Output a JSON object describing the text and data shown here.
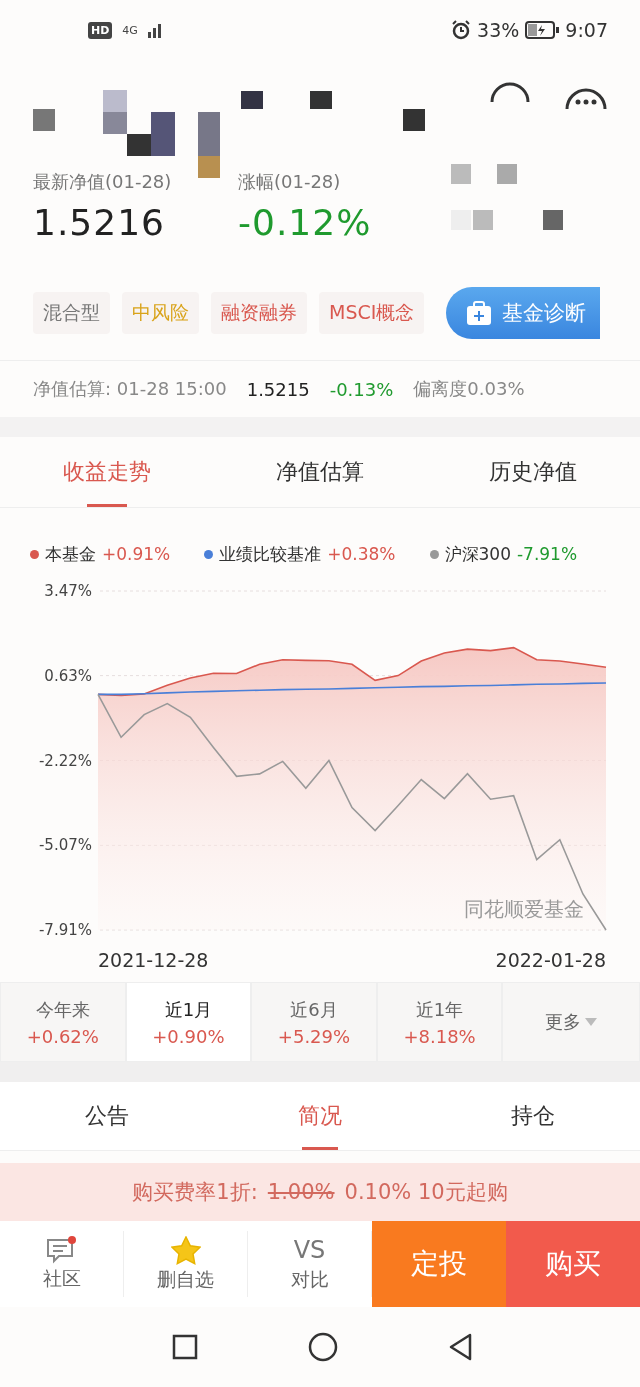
{
  "status_bar": {
    "hd": "HD",
    "network": "4G",
    "battery": "33%",
    "time": "9:07"
  },
  "fund": {
    "nav_label": "最新净值(01-28)",
    "nav": "1.5216",
    "change_label": "涨幅(01-28)",
    "change": "-0.12%",
    "change_falling": true,
    "tags": [
      {
        "label": "混合型",
        "color": "#777777"
      },
      {
        "label": "中风险",
        "color": "#d9a31a"
      },
      {
        "label": "融资融券",
        "color": "#d9584f"
      },
      {
        "label": "MSCI概念",
        "color": "#d9584f"
      }
    ],
    "diagnose_button": "基金诊断"
  },
  "estimate": {
    "label": "净值估算: 01-28 15:00",
    "value": "1.5215",
    "change": "-0.13%",
    "change_falling": true,
    "deviation": "偏离度0.03%"
  },
  "performance": {
    "tabs": [
      {
        "label": "收益走势",
        "selected": true
      },
      {
        "label": "净值估算",
        "selected": false
      },
      {
        "label": "历史净值",
        "selected": false
      }
    ],
    "legend": [
      {
        "value": "+0.91%",
        "falling": false
      },
      {
        "value": "+0.38%",
        "falling": false
      },
      {
        "value": "-7.91%",
        "falling": true
      }
    ],
    "watermark": "同花顺爱基金",
    "start_date": "2021-12-28",
    "end_date": "2022-01-28",
    "chart_data": {
      "type": "line",
      "grid": true,
      "categories": [
        null,
        null,
        null,
        null,
        null,
        null,
        null,
        null,
        null,
        null,
        null,
        null,
        null,
        null,
        null,
        null,
        null,
        null,
        null,
        null,
        null,
        null,
        null
      ],
      "ylim": [
        -7.91,
        3.47
      ],
      "yticks": [
        {
          "value": 3.47,
          "label": "3.47%"
        },
        {
          "value": 0.63,
          "label": "0.63%"
        },
        {
          "value": -2.22,
          "label": "-2.22%"
        },
        {
          "value": -5.07,
          "label": "-5.07%"
        },
        {
          "value": -7.91,
          "label": "-7.91%"
        }
      ],
      "series": [
        {
          "name": "本基金",
          "color": "#d9584f",
          "values": [
            0,
            -0.04,
            0.01,
            0.31,
            0.55,
            0.71,
            0.7,
            1.01,
            1.16,
            1.14,
            1.13,
            1.01,
            0.47,
            0.63,
            1.12,
            1.39,
            1.52,
            1.47,
            1.57,
            1.16,
            1.12,
            1.02,
            0.91
          ]
        },
        {
          "name": "业绩比较基准",
          "color": "#4a7fd8",
          "values": [
            0,
            0,
            0.02,
            0.05,
            0.08,
            0.1,
            0.12,
            0.14,
            0.16,
            0.17,
            0.18,
            0.2,
            0.22,
            0.24,
            0.26,
            0.27,
            0.29,
            0.3,
            0.32,
            0.34,
            0.35,
            0.37,
            0.38
          ]
        },
        {
          "name": "沪深300",
          "color": "#999999",
          "values": [
            0,
            -1.44,
            -0.68,
            -0.31,
            -0.77,
            -1.78,
            -2.75,
            -2.67,
            -2.25,
            -3.15,
            -2.22,
            -3.8,
            -4.57,
            -3.73,
            -2.86,
            -3.5,
            -2.66,
            -3.52,
            -3.4,
            -5.55,
            -4.88,
            -6.7,
            -7.91
          ]
        }
      ]
    },
    "periods": [
      {
        "label": "今年来",
        "value": "+0.62%",
        "selected": false
      },
      {
        "label": "近1月",
        "value": "+0.90%",
        "selected": true
      },
      {
        "label": "近6月",
        "value": "+5.29%",
        "selected": false
      },
      {
        "label": "近1年",
        "value": "+8.18%",
        "selected": false
      }
    ],
    "more_button": "更多"
  },
  "info_tabs": [
    {
      "label": "公告",
      "selected": false
    },
    {
      "label": "简况",
      "selected": true
    },
    {
      "label": "持仓",
      "selected": false
    }
  ],
  "promo": {
    "label": "购买费率1折:",
    "old_fee": "1.00%",
    "new_fee": "0.10% 10元起购"
  },
  "bottom_bar": {
    "items": [
      {
        "kind": "chat",
        "label": "社区",
        "unread": true
      },
      {
        "kind": "star",
        "label": "删自选",
        "starred": true
      },
      {
        "kind": "vs",
        "mark": "VS",
        "label": "对比"
      }
    ],
    "buttons": [
      {
        "label": "定投",
        "kind": "plan"
      },
      {
        "label": "购买",
        "kind": "buy"
      }
    ]
  }
}
